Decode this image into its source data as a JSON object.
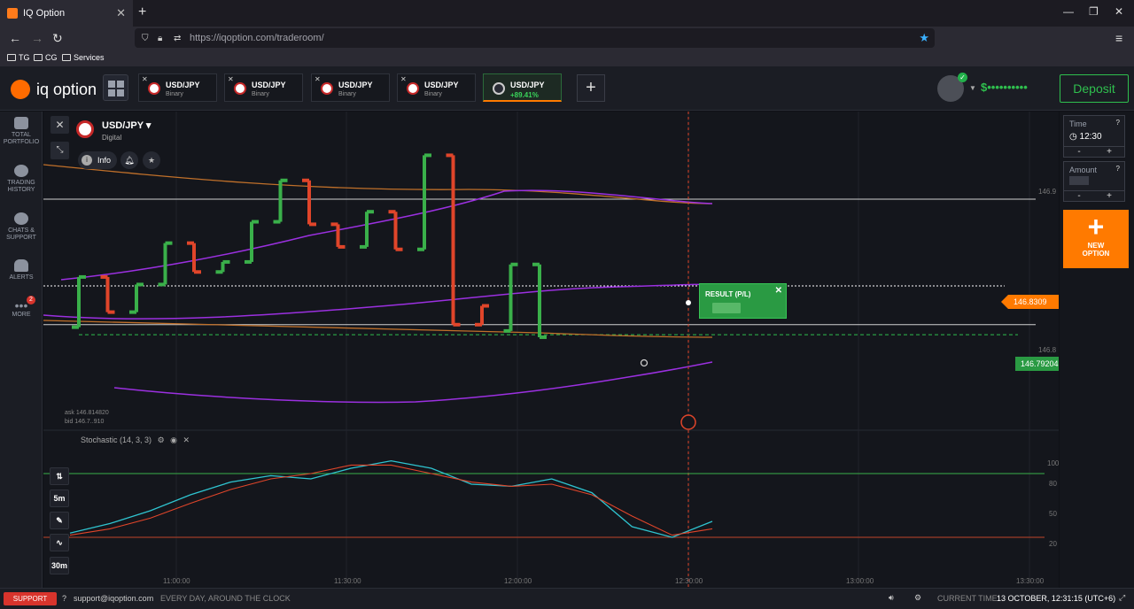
{
  "browser": {
    "tab_title": "IQ Option",
    "url_domain": "https://iqoption.com",
    "url_path": "/traderoom/",
    "bookmarks": [
      "TG",
      "CG",
      "Services"
    ]
  },
  "header": {
    "logo": "iq option",
    "asset_tabs": [
      {
        "name": "USD/JPY",
        "sub": "Binary"
      },
      {
        "name": "USD/JPY",
        "sub": "Binary"
      },
      {
        "name": "USD/JPY",
        "sub": "Binary"
      },
      {
        "name": "USD/JPY",
        "sub": "Binary"
      },
      {
        "name": "USD/JPY",
        "sub": "+89.41%"
      }
    ],
    "add_tab": "+",
    "balance": "$••••••••••",
    "deposit": "Deposit"
  },
  "sidebar": {
    "items": [
      {
        "label": "TOTAL PORTFOLIO",
        "icon": "briefcase-icon"
      },
      {
        "label": "TRADING HISTORY",
        "icon": "history-icon"
      },
      {
        "label": "CHATS & SUPPORT",
        "icon": "chat-icon"
      },
      {
        "label": "ALERTS",
        "icon": "bell-icon"
      },
      {
        "label": "MORE",
        "icon": "more-icon",
        "badge": "2"
      }
    ]
  },
  "chart_header": {
    "symbol": "USD/JPY ▾",
    "type": "Digital",
    "info": "Info"
  },
  "right_panel": {
    "time_label": "Time",
    "time_value": "12:30",
    "amount_label": "Amount",
    "minus": "-",
    "plus": "+",
    "new_option_line1": "NEW",
    "new_option_line2": "OPTION"
  },
  "price_axis": {
    "levels": [
      "146.9",
      "146.8"
    ],
    "current_price": "146.8309",
    "strike_price": "146.79204"
  },
  "ask_bid": {
    "ask": "ask 146.814820",
    "bid": "bid 146.7..910"
  },
  "result_box": {
    "label": "RESULT (P/L)"
  },
  "stochastic": {
    "label": "Stochastic (14, 3, 3)",
    "levels": [
      "100",
      "80",
      "50",
      "20"
    ]
  },
  "tools": [
    "5m",
    "30m"
  ],
  "time_axis": [
    "11:00:00",
    "11:30:00",
    "12:00:00",
    "12:30:00",
    "13:00:00",
    "13:30:00"
  ],
  "chart_data": {
    "type": "candlestick",
    "title": "USD/JPY",
    "ylabel": "",
    "ylim": [
      146.73,
      146.96
    ],
    "candles": [
      {
        "o": 146.798,
        "c": 146.838,
        "d": "up"
      },
      {
        "o": 146.838,
        "c": 146.81,
        "d": "down"
      },
      {
        "o": 146.81,
        "c": 146.832,
        "d": "up"
      },
      {
        "o": 146.832,
        "c": 146.865,
        "d": "up"
      },
      {
        "o": 146.865,
        "c": 146.842,
        "d": "down"
      },
      {
        "o": 146.842,
        "c": 146.85,
        "d": "up"
      },
      {
        "o": 146.85,
        "c": 146.882,
        "d": "up"
      },
      {
        "o": 146.882,
        "c": 146.915,
        "d": "up"
      },
      {
        "o": 146.915,
        "c": 146.88,
        "d": "down"
      },
      {
        "o": 146.88,
        "c": 146.862,
        "d": "down"
      },
      {
        "o": 146.862,
        "c": 146.89,
        "d": "up"
      },
      {
        "o": 146.89,
        "c": 146.86,
        "d": "down"
      },
      {
        "o": 146.86,
        "c": 146.935,
        "d": "up"
      },
      {
        "o": 146.935,
        "c": 146.8,
        "d": "down"
      },
      {
        "o": 146.8,
        "c": 146.815,
        "d": "down"
      },
      {
        "o": 146.795,
        "c": 146.848,
        "d": "up"
      },
      {
        "o": 146.848,
        "c": 146.79,
        "d": "up"
      }
    ],
    "stochastic_k": [
      24,
      33,
      45,
      60,
      72,
      78,
      75,
      85,
      92,
      85,
      70,
      68,
      75,
      62,
      30,
      20,
      35
    ],
    "stochastic_d": [
      22,
      28,
      38,
      52,
      65,
      75,
      80,
      88,
      88,
      80,
      72,
      68,
      70,
      60,
      40,
      22,
      28
    ]
  },
  "footer": {
    "support": "SUPPORT",
    "email": "support@iqoption.com",
    "hours": "EVERY DAY, AROUND THE CLOCK",
    "current_time_label": "CURRENT TIME:",
    "current_time_value": "13 OCTOBER, 12:31:15 (UTC+6)"
  }
}
